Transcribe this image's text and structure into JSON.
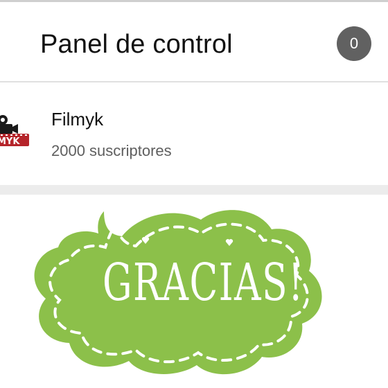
{
  "header": {
    "title": "Panel de control",
    "badge_count": "0"
  },
  "channel": {
    "name": "Filmyk",
    "subscribers": "2000 suscriptores",
    "logo_icon": "film-camera-logo",
    "logo_text": "MYK"
  },
  "sticker": {
    "text": "GRACIAS!",
    "colors": {
      "fill": "#8cc04a",
      "stitch": "#ffffff"
    }
  },
  "colors": {
    "badge_bg": "#616161",
    "divider": "#e0e0e0",
    "gap": "#ececec"
  }
}
